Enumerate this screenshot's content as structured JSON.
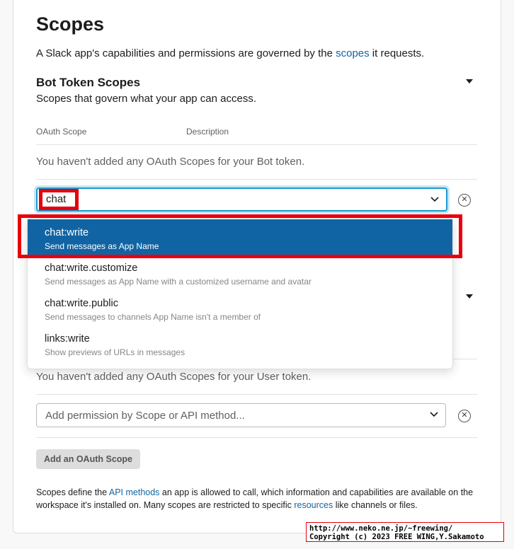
{
  "page": {
    "title": "Scopes",
    "intro_prefix": "A Slack app's capabilities and permissions are governed by the ",
    "intro_link": "scopes",
    "intro_suffix": " it requests."
  },
  "bot_section": {
    "title": "Bot Token Scopes",
    "subtitle": "Scopes that govern what your app can access.",
    "col_scope": "OAuth Scope",
    "col_description": "Description",
    "empty_message": "You haven't added any OAuth Scopes for your Bot token.",
    "search_value": "chat"
  },
  "dropdown_options": [
    {
      "name": "chat:write",
      "description": "Send messages as App Name",
      "active": true
    },
    {
      "name": "chat:write.customize",
      "description": "Send messages as App Name with a customized username and avatar",
      "active": false
    },
    {
      "name": "chat:write.public",
      "description": "Send messages to channels App Name isn't a member of",
      "active": false
    },
    {
      "name": "links:write",
      "description": "Show previews of URLs in messages",
      "active": false
    }
  ],
  "user_section": {
    "empty_message": "You haven't added any OAuth Scopes for your User token.",
    "select_placeholder": "Add permission by Scope or API method...",
    "add_button": "Add an OAuth Scope"
  },
  "footer": {
    "text1": "Scopes define the ",
    "link1": "API methods",
    "text2": " an app is allowed to call, which information and capabilities are available on the workspace it's installed on. Many scopes are restricted to specific ",
    "link2": "resources",
    "text3": " like channels or files."
  },
  "credit": {
    "line1": "http://www.neko.ne.jp/~freewing/",
    "line2": "Copyright (c) 2023 FREE WING,Y.Sakamoto"
  },
  "colors": {
    "link": "#1264a3",
    "active_option": "#1164a3",
    "highlight_box": "#e8000b",
    "focus_border": "#1d9bd1"
  }
}
